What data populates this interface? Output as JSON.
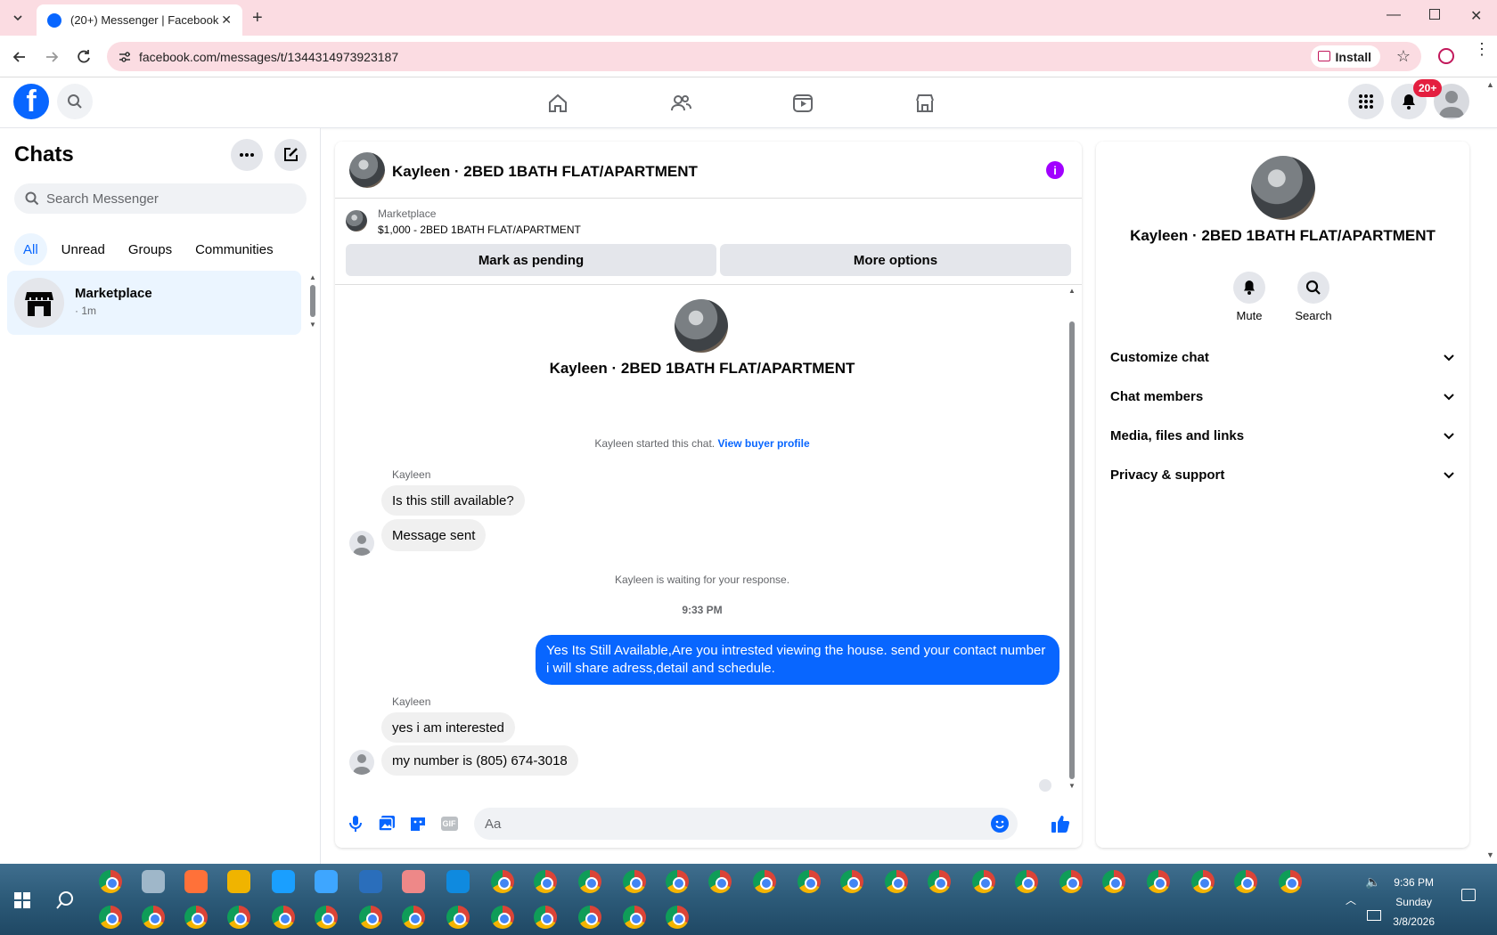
{
  "browser": {
    "tab_title": "(20+) Messenger | Facebook",
    "url": "facebook.com/messages/t/1344314973923187",
    "install_label": "Install"
  },
  "header": {
    "notification_badge": "20+"
  },
  "sidebar": {
    "title": "Chats",
    "search_placeholder": "Search Messenger",
    "filters": [
      "All",
      "Unread",
      "Groups",
      "Communities"
    ],
    "conversation": {
      "name": "Marketplace",
      "subtitle": "· 1m"
    }
  },
  "conversation": {
    "title": "Kayleen · 2BED 1BATH FLAT/APARTMENT",
    "marketplace_label": "Marketplace",
    "listing": "$1,000 - 2BED 1BATH FLAT/APARTMENT",
    "mark_pending_label": "Mark as pending",
    "more_options_label": "More options",
    "thread_title": "Kayleen · 2BED 1BATH FLAT/APARTMENT",
    "started_text": "Kayleen started this chat.",
    "view_buyer_label": "View buyer profile",
    "sender1": "Kayleen",
    "msg1": "Is this still available?",
    "msg2": "Message sent",
    "waiting_text": "Kayleen is waiting for your response.",
    "time1": "9:33 PM",
    "outgoing": "Yes Its Still Available,Are you intrested viewing the house. send your contact number i will share adress,detail and schedule.",
    "sender2": "Kayleen",
    "msg3": "yes i am interested",
    "msg4": "my number is (805) 674-3018",
    "composer_placeholder": "Aa"
  },
  "right_panel": {
    "name": "Kayleen · 2BED 1BATH FLAT/APARTMENT",
    "mute_label": "Mute",
    "search_label": "Search",
    "sections": [
      "Customize chat",
      "Chat members",
      "Media, files and links",
      "Privacy & support"
    ]
  },
  "taskbar": {
    "time": "9:36 PM",
    "day": "Sunday",
    "date": "3/8/2026"
  },
  "colors": {
    "accent": "#0866ff",
    "info": "#a100ff",
    "badge": "#e41e3f"
  }
}
